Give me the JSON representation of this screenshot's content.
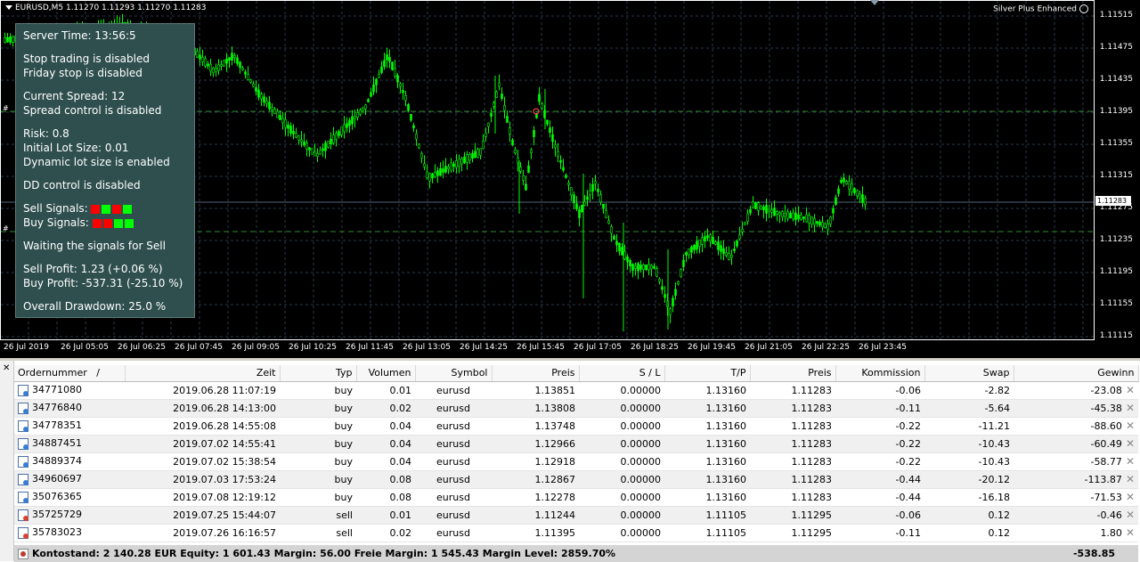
{
  "chart": {
    "symbol_info": "EURUSD,M5  1.11270 1.11293 1.11270 1.11283",
    "expert_name": "Silver Plus Enhanced",
    "current_price": "1.11283",
    "price_labels": [
      "1.11515",
      "1.11475",
      "1.11435",
      "1.11395",
      "1.11355",
      "1.11315",
      "1.11275",
      "1.11235",
      "1.11195",
      "1.11155",
      "1.11115"
    ],
    "time_labels": [
      "26 Jul 2019",
      "26 Jul 05:05",
      "26 Jul 06:25",
      "26 Jul 07:45",
      "26 Jul 09:05",
      "26 Jul 10:25",
      "26 Jul 11:45",
      "26 Jul 13:05",
      "26 Jul 14:25",
      "26 Jul 15:45",
      "26 Jul 17:05",
      "26 Jul 18:25",
      "26 Jul 19:45",
      "26 Jul 21:05",
      "26 Jul 22:25",
      "26 Jul 23:45"
    ],
    "candle_color": "#00ff00",
    "background": "#000000",
    "grid_color": "#2a3a4a",
    "level_line_color": "#2e8b2e"
  },
  "panel": {
    "server_time": "Server Time: 13:56:5",
    "stop_trading": "Stop trading is disabled",
    "friday_stop": "Friday stop is disabled",
    "current_spread": "Current Spread: 12",
    "spread_control": "Spread control is disabled",
    "risk": "Risk: 0.8",
    "initial_lot": "Initial Lot Size: 0.01",
    "dynamic_lot": "Dynamic lot size is enabled",
    "dd_control": "DD control is disabled",
    "sell_signals_label": "Sell Signals:",
    "buy_signals_label": "Buy Signals:",
    "sell_signals": [
      "#ff0000",
      "#00ff00",
      "#ff0000",
      "#00ff00"
    ],
    "buy_signals": [
      "#ff0000",
      "#ff0000",
      "#00ff00",
      "#00ff00"
    ],
    "waiting": "Waiting the signals for Sell",
    "sell_profit": "Sell Profit: 1.23  (+0.06 %)",
    "buy_profit": "Buy Profit: -537.31  (-25.10 %)",
    "overall_dd": "Overall Drawdown: 25.0 %"
  },
  "terminal": {
    "columns": [
      "Ordernummer",
      "Zeit",
      "Typ",
      "Volumen",
      "Symbol",
      "Preis",
      "S / L",
      "T/P",
      "Preis",
      "Kommission",
      "Swap",
      "Gewinn"
    ],
    "sort_indicator": "/",
    "rows": [
      {
        "order": "34771080",
        "time": "2019.06.28 11:07:19",
        "type": "buy",
        "volume": "0.01",
        "symbol": "eurusd",
        "open_price": "1.13851",
        "sl": "0.00000",
        "tp": "1.13160",
        "price": "1.11283",
        "commission": "-0.06",
        "swap": "-2.82",
        "profit": "-23.08",
        "side_color": "#3a7bd5"
      },
      {
        "order": "34776840",
        "time": "2019.06.28 14:13:00",
        "type": "buy",
        "volume": "0.02",
        "symbol": "eurusd",
        "open_price": "1.13808",
        "sl": "0.00000",
        "tp": "1.13160",
        "price": "1.11283",
        "commission": "-0.11",
        "swap": "-5.64",
        "profit": "-45.38",
        "side_color": "#3a7bd5"
      },
      {
        "order": "34778351",
        "time": "2019.06.28 14:55:08",
        "type": "buy",
        "volume": "0.04",
        "symbol": "eurusd",
        "open_price": "1.13748",
        "sl": "0.00000",
        "tp": "1.13160",
        "price": "1.11283",
        "commission": "-0.22",
        "swap": "-11.21",
        "profit": "-88.60",
        "side_color": "#3a7bd5"
      },
      {
        "order": "34887451",
        "time": "2019.07.02 14:55:41",
        "type": "buy",
        "volume": "0.04",
        "symbol": "eurusd",
        "open_price": "1.12966",
        "sl": "0.00000",
        "tp": "1.13160",
        "price": "1.11283",
        "commission": "-0.22",
        "swap": "-10.43",
        "profit": "-60.49",
        "side_color": "#3a7bd5"
      },
      {
        "order": "34889374",
        "time": "2019.07.02 15:38:54",
        "type": "buy",
        "volume": "0.04",
        "symbol": "eurusd",
        "open_price": "1.12918",
        "sl": "0.00000",
        "tp": "1.13160",
        "price": "1.11283",
        "commission": "-0.22",
        "swap": "-10.43",
        "profit": "-58.77",
        "side_color": "#3a7bd5"
      },
      {
        "order": "34960697",
        "time": "2019.07.03 17:53:24",
        "type": "buy",
        "volume": "0.08",
        "symbol": "eurusd",
        "open_price": "1.12867",
        "sl": "0.00000",
        "tp": "1.13160",
        "price": "1.11283",
        "commission": "-0.44",
        "swap": "-20.12",
        "profit": "-113.87",
        "side_color": "#3a7bd5"
      },
      {
        "order": "35076365",
        "time": "2019.07.08 12:19:12",
        "type": "buy",
        "volume": "0.08",
        "symbol": "eurusd",
        "open_price": "1.12278",
        "sl": "0.00000",
        "tp": "1.13160",
        "price": "1.11283",
        "commission": "-0.44",
        "swap": "-16.18",
        "profit": "-71.53",
        "side_color": "#3a7bd5"
      },
      {
        "order": "35725729",
        "time": "2019.07.25 15:44:07",
        "type": "sell",
        "volume": "0.01",
        "symbol": "eurusd",
        "open_price": "1.11244",
        "sl": "0.00000",
        "tp": "1.11105",
        "price": "1.11295",
        "commission": "-0.06",
        "swap": "0.12",
        "profit": "-0.46",
        "side_color": "#d9432f"
      },
      {
        "order": "35783023",
        "time": "2019.07.26 16:16:57",
        "type": "sell",
        "volume": "0.02",
        "symbol": "eurusd",
        "open_price": "1.11395",
        "sl": "0.00000",
        "tp": "1.11105",
        "price": "1.11295",
        "commission": "-0.11",
        "swap": "0.12",
        "profit": "1.80",
        "side_color": "#d9432f"
      }
    ],
    "summary": {
      "text": "Kontostand: 2 140.28 EUR  Equity: 1 601.43  Margin: 56.00  Freie Margin: 1 545.43  Margin Level: 2859.70%",
      "total": "-538.85"
    }
  }
}
